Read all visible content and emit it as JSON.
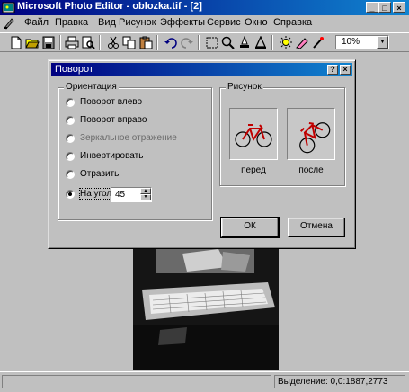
{
  "window": {
    "title": "Microsoft Photo Editor - oblozka.tif - [2]",
    "minimize": "_",
    "maximize": "□",
    "close": "×"
  },
  "menu": [
    {
      "label": "Файл"
    },
    {
      "label": "Правка"
    },
    {
      "label": "Вид"
    },
    {
      "label": "Рисунок"
    },
    {
      "label": "Эффекты"
    },
    {
      "label": "Сервис"
    },
    {
      "label": "Окно"
    },
    {
      "label": "Справка"
    }
  ],
  "toolbar": {
    "zoom_value": "10%",
    "icons": [
      "new-icon",
      "open-icon",
      "save-icon",
      "print-icon",
      "print-preview-icon",
      "cut-icon",
      "copy-icon",
      "paste-icon",
      "undo-icon",
      "redo-icon",
      "select-icon",
      "zoom-icon",
      "smudge-icon",
      "sharpen-icon",
      "balance-icon",
      "eraser-icon",
      "transparent-icon"
    ]
  },
  "dialog": {
    "title": "Поворот",
    "help_btn": "?",
    "close_btn": "×",
    "orientation": {
      "label": "Ориентация",
      "options": [
        {
          "label": "Поворот влево",
          "selected": false,
          "dim": false
        },
        {
          "label": "Поворот вправо",
          "selected": false,
          "dim": false
        },
        {
          "label": "Зеркальное отражение",
          "selected": false,
          "dim": true
        },
        {
          "label": "Инвертировать",
          "selected": false,
          "dim": false
        },
        {
          "label": "Отразить",
          "selected": false,
          "dim": false
        },
        {
          "label": "На угол:",
          "selected": true,
          "dim": false
        }
      ],
      "angle_value": "45"
    },
    "picture": {
      "label": "Рисунок",
      "before": "перед",
      "after": "после"
    },
    "ok": "ОК",
    "cancel": "Отмена"
  },
  "status": {
    "left": "",
    "right": "Выделение: 0,0:1887,2773"
  }
}
